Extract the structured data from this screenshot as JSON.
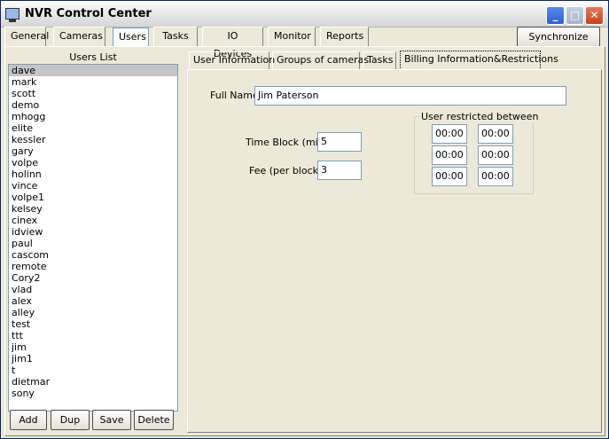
{
  "window": {
    "title": "NVR Control Center"
  },
  "main_tabs": [
    {
      "label": "General"
    },
    {
      "label": "Cameras"
    },
    {
      "label": "Users"
    },
    {
      "label": "Tasks"
    },
    {
      "label": "IO Devices"
    },
    {
      "label": "Monitor"
    },
    {
      "label": "Reports"
    }
  ],
  "main_tabs_active": "Users",
  "toolbar": {
    "sync_label": "Synchronize"
  },
  "users_panel": {
    "title": "Users List",
    "users": [
      "dave",
      "mark",
      "scott",
      "demo",
      "mhogg",
      "elite",
      "kessler",
      "gary",
      "volpe",
      "holinn",
      "vince",
      "volpe1",
      "kelsey",
      "cinex",
      "idview",
      "paul",
      "cascom",
      "remote",
      "Cory2",
      "vlad",
      "alex",
      "alley",
      "test",
      "ttt",
      "jim",
      "jim1",
      "t",
      "dietmar",
      "sony"
    ],
    "selected": "dave",
    "buttons": {
      "add": "Add",
      "dup": "Dup",
      "save": "Save",
      "delete": "Delete"
    }
  },
  "inner_tabs": [
    {
      "label": "User Information"
    },
    {
      "label": "Groups of cameras"
    },
    {
      "label": "Tasks"
    },
    {
      "label": "Billing Information&Restrictions"
    }
  ],
  "inner_tabs_active": "Billing Information&Restrictions",
  "billing": {
    "full_name_label": "Full Name",
    "full_name_value": "Jim Paterson",
    "time_block_label": "Time Block (min)",
    "time_block_value": "5",
    "fee_label": "Fee (per block)",
    "fee_value": "3",
    "restriction_title": "User restricted between",
    "time_slots": [
      {
        "from": "00:00",
        "to": "00:00"
      },
      {
        "from": "00:00",
        "to": "00:00"
      },
      {
        "from": "00:00",
        "to": "00:00"
      }
    ]
  },
  "colors": {
    "window_bg": "#ece9d8",
    "selection_bg": "#c5c5c5",
    "input_border": "#7f9db9"
  }
}
